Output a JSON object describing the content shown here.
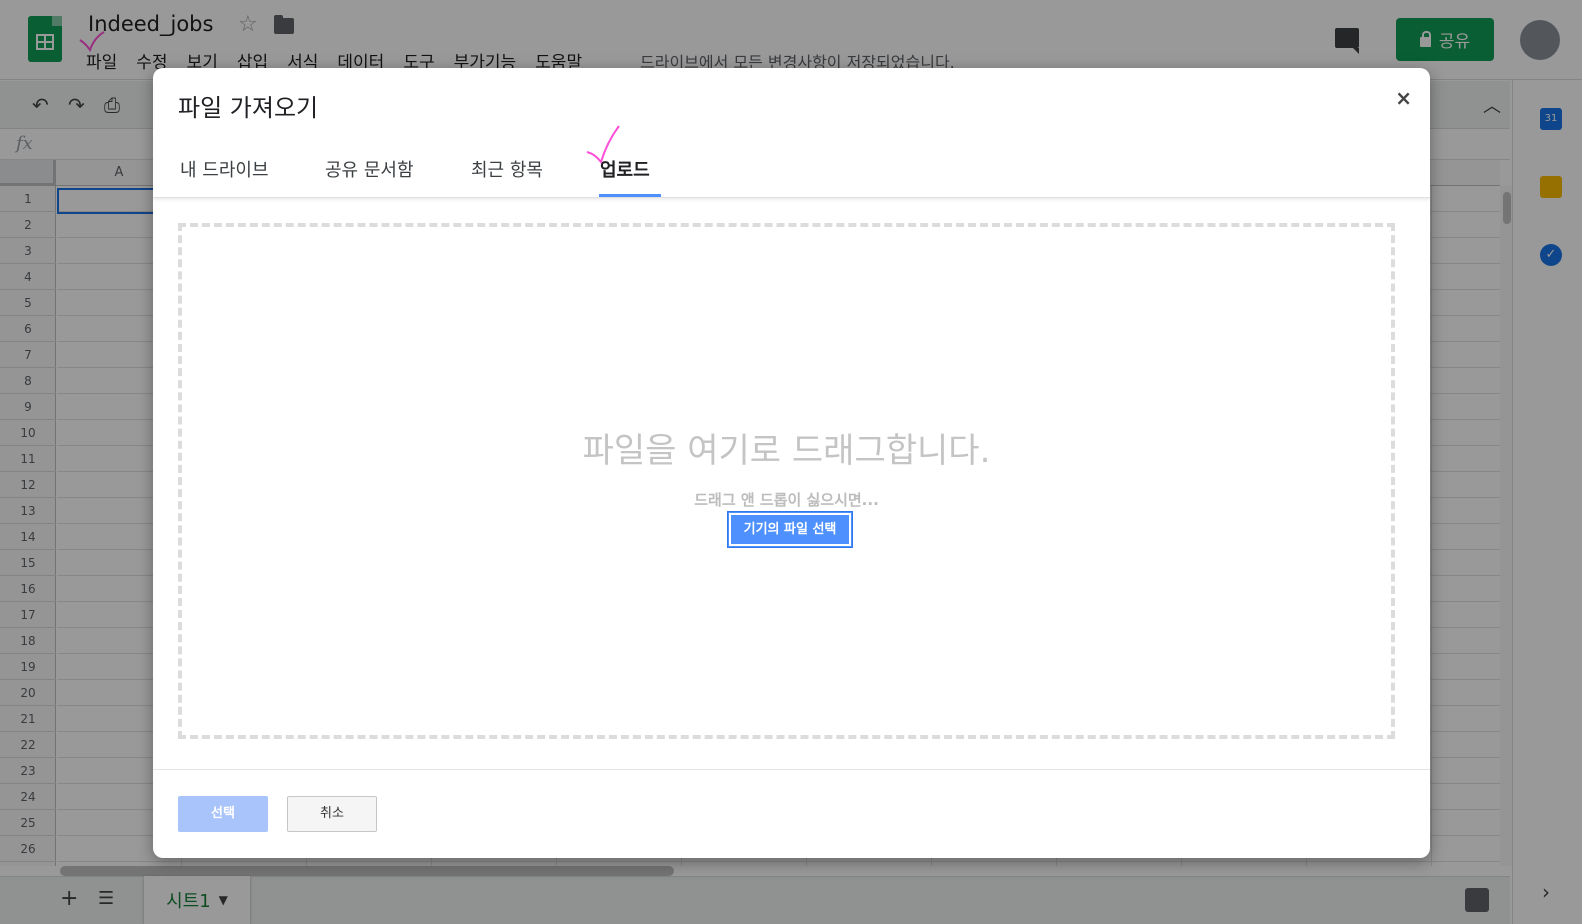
{
  "app": {
    "doc_title": "Indeed_jobs",
    "menu": [
      "파일",
      "수정",
      "보기",
      "삽입",
      "서식",
      "데이터",
      "도구",
      "부가기능",
      "도움말"
    ],
    "save_status": "드라이브에서 모든 변경사항이 저장되었습니다.",
    "share_label": "공유",
    "fx_label": "fx",
    "column_a": "A",
    "rows": [
      "1",
      "2",
      "3",
      "4",
      "5",
      "6",
      "7",
      "8",
      "9",
      "10",
      "11",
      "12",
      "13",
      "14",
      "15",
      "16",
      "17",
      "18",
      "19",
      "20",
      "21",
      "22",
      "23",
      "24",
      "25",
      "26"
    ],
    "sheet_tab": "시트1",
    "calendar_day": "31"
  },
  "dialog": {
    "title": "파일 가져오기",
    "close_label": "×",
    "tabs": [
      "내 드라이브",
      "공유 문서함",
      "최근 항목",
      "업로드"
    ],
    "active_tab": "업로드",
    "drop_title": "파일을 여기로 드래그합니다.",
    "drop_sub": "드래그 앤 드롭이 싫으시면...",
    "pick_button": "기기의 파일 선택",
    "select_button": "선택",
    "cancel_button": "취소"
  },
  "colors": {
    "brand_green": "#0f9d58",
    "accent_blue": "#4d90fe",
    "disabled_blue": "#a9c4fb",
    "annotation_pink": "#ff4fd8"
  }
}
